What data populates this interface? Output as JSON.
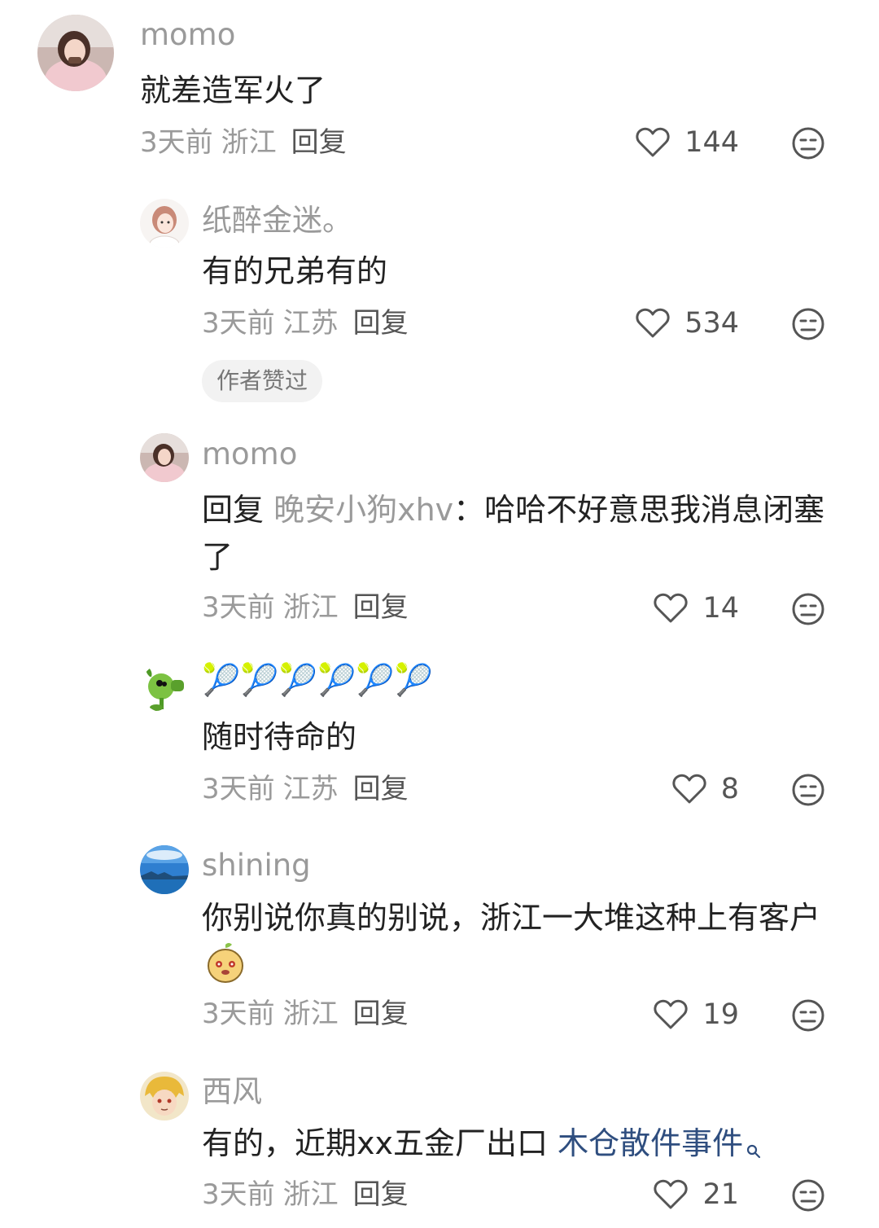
{
  "comments": [
    {
      "username": "momo",
      "text": "就差造军火了",
      "time": "3天前",
      "location": "浙江",
      "reply": "回复",
      "likes": "144",
      "avatar_icon": "woman-photo-avatar"
    },
    {
      "username": "纸醉金迷。",
      "text": "有的兄弟有的",
      "time": "3天前",
      "location": "江苏",
      "reply": "回复",
      "likes": "534",
      "badge": "作者赞过",
      "avatar_icon": "anime-girl-avatar"
    },
    {
      "username": "momo",
      "reply_prefix": "回复",
      "reply_to": "晚安小狗xhv",
      "text": "：哈哈不好意思我消息闭塞了",
      "time": "3天前",
      "location": "浙江",
      "reply": "回复",
      "likes": "14",
      "avatar_icon": "woman-photo-avatar"
    },
    {
      "username": "🎾🎾🎾🎾🎾🎾",
      "text": "随时待命的",
      "time": "3天前",
      "location": "江苏",
      "reply": "回复",
      "likes": "8",
      "avatar_icon": "peashooter-avatar"
    },
    {
      "username": "shining",
      "text": "你别说你真的别说，浙江一大堆这种上有客户",
      "emoji": "cute-creature-sticker",
      "time": "3天前",
      "location": "浙江",
      "reply": "回复",
      "likes": "19",
      "avatar_icon": "sea-sky-avatar"
    },
    {
      "username": "西风",
      "text": "有的，近期xx五金厂出口",
      "link": "木仓散件事件",
      "time": "3天前",
      "location": "浙江",
      "reply": "回复",
      "likes": "21",
      "avatar_icon": "golden-hair-avatar"
    }
  ]
}
